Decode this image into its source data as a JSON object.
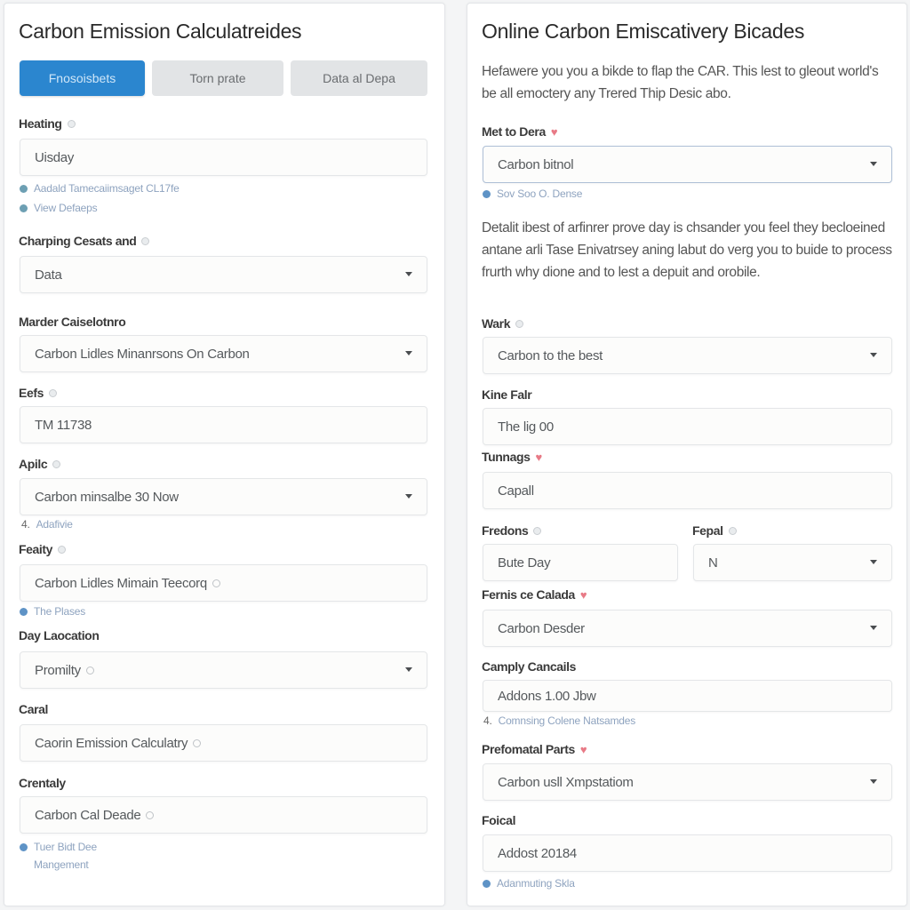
{
  "left_panel": {
    "title": "Carbon Emission Calculatreides",
    "tabs": [
      {
        "label": "Fnosoisbets",
        "active": true
      },
      {
        "label": "Torn prate",
        "active": false
      },
      {
        "label": "Data al Depa",
        "active": false
      }
    ],
    "fields": [
      {
        "label": "Heating",
        "value": "Uisday",
        "type": "text"
      },
      {
        "label": "Charping Cesats and",
        "value": "Data",
        "type": "select"
      },
      {
        "label": "Marder Caiselotnro",
        "value": "Carbon Lidles Minanrsons On Carbon",
        "type": "select"
      },
      {
        "label": "Eefs",
        "value": "TM 11738",
        "type": "text"
      },
      {
        "label": "Apilc",
        "value": "Carbon minsalbe 30 Now",
        "type": "select"
      },
      {
        "label": "Feaity",
        "value": "Carbon Lidles Mimain Teecorq",
        "type": "text"
      },
      {
        "label": "Day Laocation",
        "value": "Promilty",
        "type": "select"
      },
      {
        "label": "Caral",
        "value": "Caorin Emission Calculatry",
        "type": "text"
      },
      {
        "label": "Crentaly",
        "value": "Carbon Cal Deade",
        "type": "text"
      }
    ],
    "hints": {
      "heating_1": "Aadald Tamecaiimsaget CL17fe",
      "heating_2": "View Defaeps",
      "apilc_num": "4.",
      "apilc": "Adafivie",
      "feaity": "The Plases",
      "crentaly_1": "Tuer Bidt Dee",
      "crentaly_2": "Mangement"
    }
  },
  "right_panel": {
    "title": "Online Carbon Emiscativery Bicades",
    "intro": "Hefawere you you a bikde to flap the CAR. This lest to gleout world's be all emoctery any Trered Thip Desic abo.",
    "description": "Detalit ibest of arfinrer prove day is chsander you feel they becloeined antane arli Tase Enivatrsey aning labut do verg you to buide to process frurth why dione and to lest a depuit and orobile.",
    "fields": [
      {
        "label": "Met to Dera",
        "value": "Carbon bitnol",
        "type": "select",
        "required": true
      },
      {
        "label": "Wark",
        "value": "Carbon to the best",
        "type": "select"
      },
      {
        "label": "Kine Falr",
        "value": "The lig 00",
        "type": "text"
      },
      {
        "label": "Tunnags",
        "value": "Capall",
        "type": "text",
        "required": true
      },
      {
        "label": "Fredons",
        "value": "Bute Day",
        "type": "text"
      },
      {
        "label": "Fepal",
        "value": "N",
        "type": "select"
      },
      {
        "label": "Fernis ce Calada",
        "value": "Carbon Desder",
        "type": "select",
        "required": true
      },
      {
        "label": "Camply Cancails",
        "value": "Addons 1.00 Jbw",
        "type": "text"
      },
      {
        "label": "Prefomatal Parts",
        "value": "Carbon usll Xmpstatiom",
        "type": "select",
        "required": true
      },
      {
        "label": "Foical",
        "value": "Addost 20184",
        "type": "text"
      }
    ],
    "hints": {
      "met": "Sov Soo O. Dense",
      "camply_num": "4.",
      "camply": "Comnsing Colene Natsamdes",
      "foical": "Adanmuting Skla"
    }
  },
  "colors": {
    "accent": "#2b86cf",
    "required_heart": "#e87a86",
    "hint_text": "#8ea3bf"
  }
}
